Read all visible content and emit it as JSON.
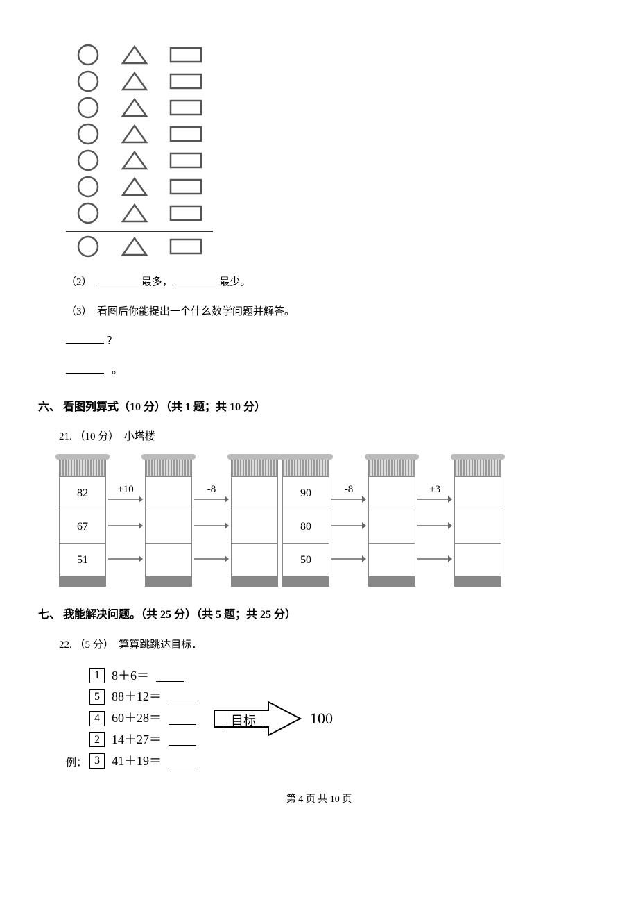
{
  "q2": {
    "prefix": "（2）",
    "mid1": "最多，",
    "mid2": "最少。"
  },
  "q3": {
    "prefix": "（3）",
    "text": "看图后你能提出一个什么数学问题并解答。",
    "qm": "？",
    "period": "。"
  },
  "sec6": {
    "label": "六、",
    "title": "看图列算式（10 分）（共 1 题；共 10 分）"
  },
  "q21": {
    "num": "21.",
    "pts": "（10 分）",
    "title": "小塔楼"
  },
  "towers": {
    "set1": {
      "op1": "+10",
      "op2": "-8",
      "col1": [
        "82",
        "67",
        "51"
      ],
      "col2": [
        "",
        "",
        ""
      ],
      "col3": [
        "",
        "",
        ""
      ]
    },
    "set2": {
      "op1": "-8",
      "op2": "+3",
      "col1": [
        "90",
        "80",
        "50"
      ],
      "col2": [
        "",
        "",
        ""
      ],
      "col3": [
        "",
        "",
        ""
      ]
    }
  },
  "sec7": {
    "label": "七、",
    "title": "我能解决问题。（共 25 分）（共 5 题；共 25 分）"
  },
  "q22": {
    "num": "22.",
    "pts": "（5 分）",
    "title": "算算跳跳达目标．"
  },
  "hops": [
    {
      "box": "1",
      "expr": "8＋6＝"
    },
    {
      "box": "5",
      "expr": "88＋12＝"
    },
    {
      "box": "4",
      "expr": "60＋28＝"
    },
    {
      "box": "2",
      "expr": "14＋27＝"
    },
    {
      "box": "3",
      "expr": "41＋19＝"
    }
  ],
  "goal": {
    "label": "目标",
    "value": "100"
  },
  "example_label": "例：",
  "footer": {
    "p1": "第",
    "n1": "4",
    "p2": "页 共",
    "n2": "10",
    "p3": "页"
  }
}
